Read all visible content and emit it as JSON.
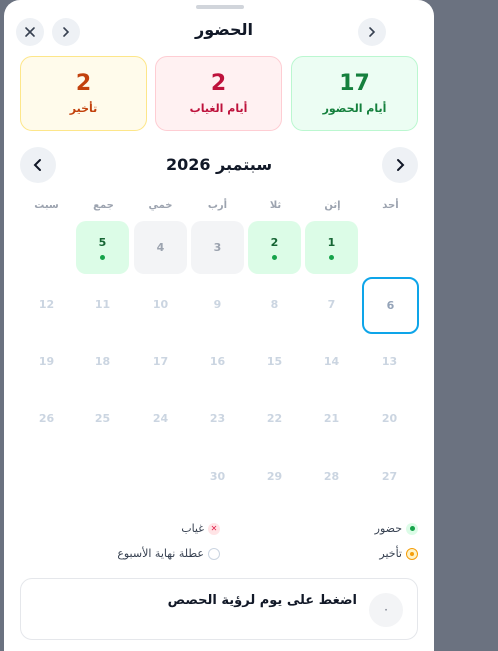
{
  "header": {
    "title": "الحضور"
  },
  "stats": {
    "present": {
      "value": "17",
      "label": "أيام الحضور"
    },
    "absent": {
      "value": "2",
      "label": "أيام الغياب"
    },
    "late": {
      "value": "2",
      "label": "تأخير"
    }
  },
  "calendar": {
    "month_label": "سبتمبر 2026",
    "weekdays": [
      "أحد",
      "إثن",
      "ثلا",
      "أرب",
      "خمي",
      "جمع",
      "سبت"
    ],
    "days": [
      {
        "d": "1",
        "col": 1,
        "row": 0,
        "state": "present"
      },
      {
        "d": "2",
        "col": 2,
        "row": 0,
        "state": "present"
      },
      {
        "d": "3",
        "col": 3,
        "row": 0,
        "state": "weekend"
      },
      {
        "d": "4",
        "col": 4,
        "row": 0,
        "state": "weekend"
      },
      {
        "d": "5",
        "col": 5,
        "row": 0,
        "state": "present"
      },
      {
        "d": "6",
        "col": 0,
        "row": 1,
        "state": "today"
      },
      {
        "d": "7",
        "col": 1,
        "row": 1,
        "state": "none"
      },
      {
        "d": "8",
        "col": 2,
        "row": 1,
        "state": "none"
      },
      {
        "d": "9",
        "col": 3,
        "row": 1,
        "state": "none"
      },
      {
        "d": "10",
        "col": 4,
        "row": 1,
        "state": "none"
      },
      {
        "d": "11",
        "col": 5,
        "row": 1,
        "state": "none"
      },
      {
        "d": "12",
        "col": 6,
        "row": 1,
        "state": "none"
      },
      {
        "d": "13",
        "col": 0,
        "row": 2,
        "state": "none"
      },
      {
        "d": "14",
        "col": 1,
        "row": 2,
        "state": "none"
      },
      {
        "d": "15",
        "col": 2,
        "row": 2,
        "state": "none"
      },
      {
        "d": "16",
        "col": 3,
        "row": 2,
        "state": "none"
      },
      {
        "d": "17",
        "col": 4,
        "row": 2,
        "state": "none"
      },
      {
        "d": "18",
        "col": 5,
        "row": 2,
        "state": "none"
      },
      {
        "d": "19",
        "col": 6,
        "row": 2,
        "state": "none"
      },
      {
        "d": "20",
        "col": 0,
        "row": 3,
        "state": "none"
      },
      {
        "d": "21",
        "col": 1,
        "row": 3,
        "state": "none"
      },
      {
        "d": "22",
        "col": 2,
        "row": 3,
        "state": "none"
      },
      {
        "d": "23",
        "col": 3,
        "row": 3,
        "state": "none"
      },
      {
        "d": "24",
        "col": 4,
        "row": 3,
        "state": "none"
      },
      {
        "d": "25",
        "col": 5,
        "row": 3,
        "state": "none"
      },
      {
        "d": "26",
        "col": 6,
        "row": 3,
        "state": "none"
      },
      {
        "d": "27",
        "col": 0,
        "row": 4,
        "state": "none"
      },
      {
        "d": "28",
        "col": 1,
        "row": 4,
        "state": "none"
      },
      {
        "d": "29",
        "col": 2,
        "row": 4,
        "state": "none"
      },
      {
        "d": "30",
        "col": 3,
        "row": 4,
        "state": "none"
      }
    ]
  },
  "legend": {
    "present": "حضور",
    "absent": "غياب",
    "late": "تأخير",
    "weekend": "عطلة نهاية الأسبوع"
  },
  "hint": {
    "text": "اضغط على يوم لرؤية الحصص",
    "icon": "·"
  },
  "colors": {
    "present": "#16a34a",
    "absent": "#e11d48",
    "late": "#f59e0b",
    "today_border": "#0ea5e9"
  }
}
